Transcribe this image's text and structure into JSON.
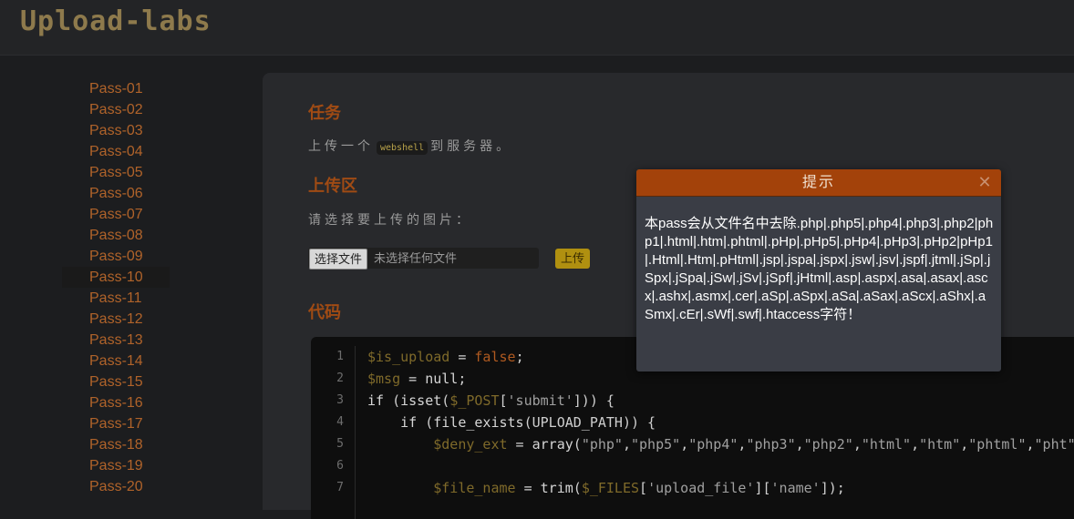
{
  "header": {
    "logo": "Upload-labs"
  },
  "sidebar": {
    "items": [
      {
        "label": "Pass-01"
      },
      {
        "label": "Pass-02"
      },
      {
        "label": "Pass-03"
      },
      {
        "label": "Pass-04"
      },
      {
        "label": "Pass-05"
      },
      {
        "label": "Pass-06"
      },
      {
        "label": "Pass-07"
      },
      {
        "label": "Pass-08"
      },
      {
        "label": "Pass-09"
      },
      {
        "label": "Pass-10"
      },
      {
        "label": "Pass-11"
      },
      {
        "label": "Pass-12"
      },
      {
        "label": "Pass-13"
      },
      {
        "label": "Pass-14"
      },
      {
        "label": "Pass-15"
      },
      {
        "label": "Pass-16"
      },
      {
        "label": "Pass-17"
      },
      {
        "label": "Pass-18"
      },
      {
        "label": "Pass-19"
      },
      {
        "label": "Pass-20"
      }
    ],
    "active": "Pass-10"
  },
  "main": {
    "task_title": "任务",
    "task_prefix": "上传一个",
    "task_code": "webshell",
    "task_suffix": "到服务器。",
    "upload_title": "上传区",
    "upload_prompt": "请选择要上传的图片：",
    "file_button": "选择文件",
    "file_status": "未选择任何文件",
    "upload_button": "上传",
    "code_title": "代码",
    "code_line_numbers": [
      "1",
      "2",
      "3",
      "4",
      "5",
      "6",
      "7"
    ]
  },
  "modal": {
    "title": "提示",
    "close_icon": "close-icon",
    "message": "本pass会从文件名中去除.php|.php5|.php4|.php3|.php2|php1|.html|.htm|.phtml|.pHp|.pHp5|.pHp4|.pHp3|.pHp2|pHp1|.Html|.Htm|.pHtml|.jsp|.jspa|.jspx|.jsw|.jsv|.jspf|.jtml|.jSp|.jSpx|.jSpa|.jSw|.jSv|.jSpf|.jHtml|.asp|.aspx|.asa|.asax|.ascx|.ashx|.asmx|.cer|.aSp|.aSpx|.aSa|.aSax|.aScx|.aShx|.aSmx|.cEr|.sWf|.swf|.htaccess字符！"
  },
  "colors": {
    "accent": "#b0632a",
    "modal_header": "#a3420a",
    "upload_button": "#b09010"
  }
}
